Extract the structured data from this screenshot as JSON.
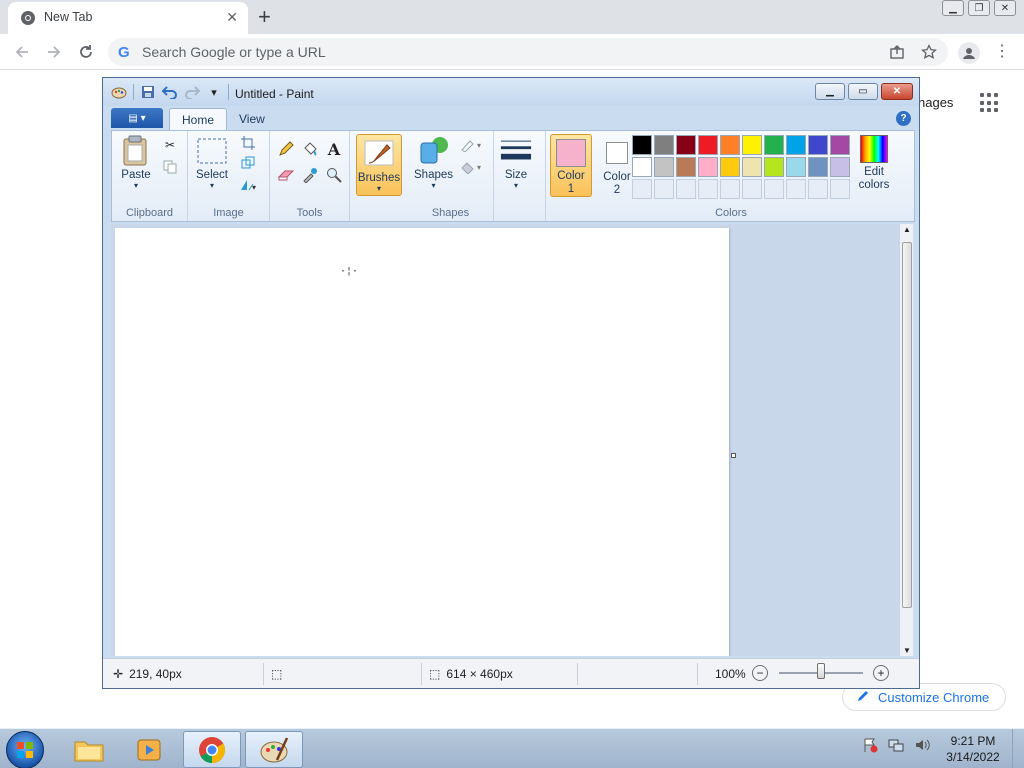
{
  "chrome": {
    "tab_title": "New Tab",
    "omnibox_placeholder": "Search Google or type a URL",
    "ntp_images_link": "nages",
    "customize_label": "Customize Chrome"
  },
  "paint": {
    "title": "Untitled - Paint",
    "tabs": [
      "Home",
      "View"
    ],
    "groups": {
      "clipboard": "Clipboard",
      "image": "Image",
      "tools": "Tools",
      "shapes": "Shapes",
      "colors": "Colors"
    },
    "buttons": {
      "paste": "Paste",
      "select": "Select",
      "brushes": "Brushes",
      "shapes": "Shapes",
      "size": "Size",
      "color1_line1": "Color",
      "color1_line2": "1",
      "color2_line1": "Color",
      "color2_line2": "2",
      "edit_colors_line1": "Edit",
      "edit_colors_line2": "colors"
    },
    "color1_value": "#f7b2cb",
    "color2_value": "#ffffff",
    "palette_row1": [
      "#000000",
      "#7f7f7f",
      "#880015",
      "#ed1c24",
      "#ff7f27",
      "#fff200",
      "#22b14c",
      "#00a2e8",
      "#3f48cc",
      "#a349a4"
    ],
    "palette_row2": [
      "#ffffff",
      "#c3c3c3",
      "#b97a57",
      "#ffaec9",
      "#ffc90e",
      "#efe4b0",
      "#b5e61d",
      "#99d9ea",
      "#7092be",
      "#c8bfe7"
    ],
    "status": {
      "cursor_pos": "219, 40px",
      "image_size": "614 × 460px",
      "zoom": "100%"
    },
    "zoom_level": 1.0
  },
  "taskbar": {
    "time": "9:21 PM",
    "date": "3/14/2022"
  }
}
